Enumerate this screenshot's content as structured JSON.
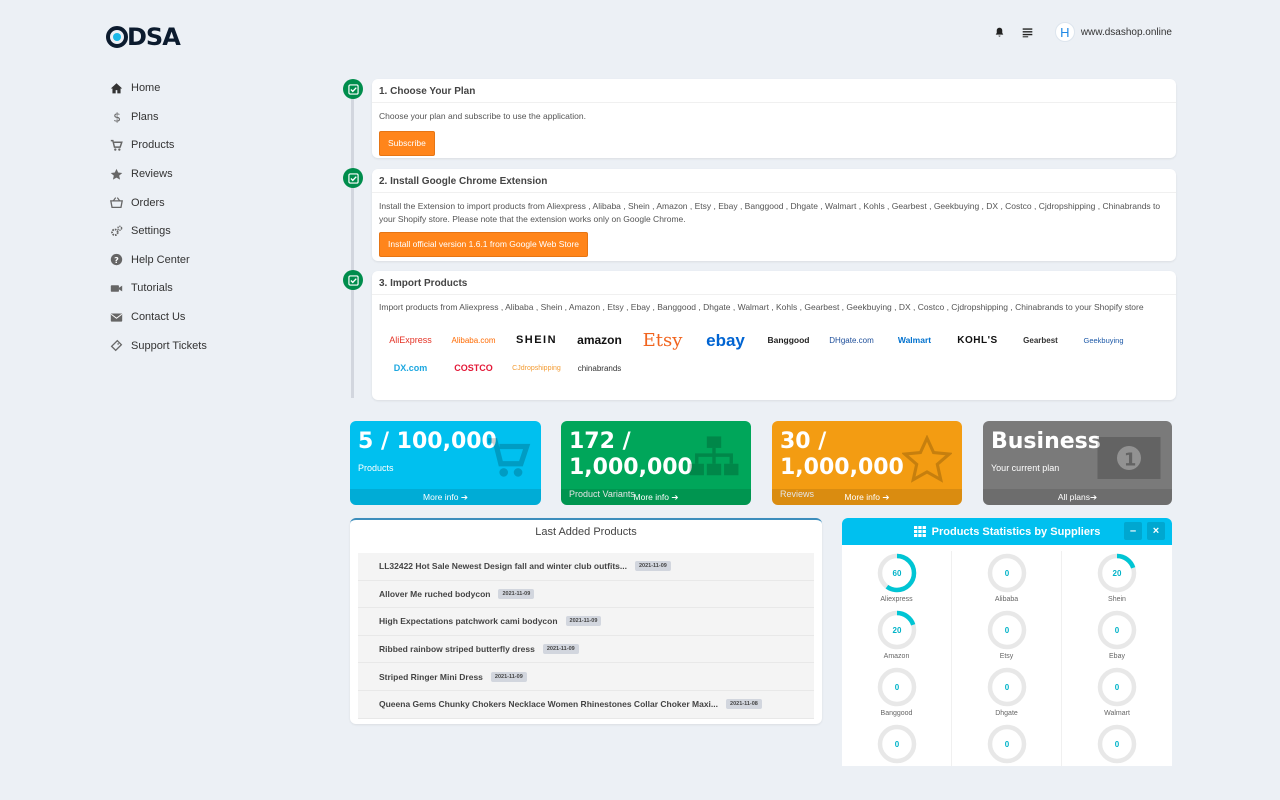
{
  "header": {
    "logo_text": "DSA",
    "site": "www.dsashop.online",
    "avatar_letter": "H"
  },
  "sidebar": {
    "items": [
      {
        "label": "Home",
        "icon": "home-icon"
      },
      {
        "label": "Plans",
        "icon": "dollar-icon"
      },
      {
        "label": "Products",
        "icon": "cart-icon"
      },
      {
        "label": "Reviews",
        "icon": "star-icon"
      },
      {
        "label": "Orders",
        "icon": "basket-icon"
      },
      {
        "label": "Settings",
        "icon": "gears-icon"
      },
      {
        "label": "Help Center",
        "icon": "question-icon"
      },
      {
        "label": "Tutorials",
        "icon": "video-icon"
      },
      {
        "label": "Contact Us",
        "icon": "envelope-icon"
      },
      {
        "label": "Support Tickets",
        "icon": "ticket-icon"
      }
    ]
  },
  "steps": [
    {
      "title": "1. Choose Your Plan",
      "text": "Choose your plan and subscribe to use the application.",
      "button": "Subscribe"
    },
    {
      "title": "2. Install Google Chrome Extension",
      "text": "Install the Extension to import products from Aliexpress , Alibaba , Shein , Amazon , Etsy , Ebay , Banggood , Dhgate , Walmart , Kohls , Gearbest , Geekbuying , DX , Costco , Cjdropshipping , Chinabrands to your Shopify store. Please note that the extension works only on Google Chrome.",
      "button": "Install official version 1.6.1 from Google Web Store"
    },
    {
      "title": "3. Import Products",
      "text": "Import products from Aliexpress , Alibaba , Shein , Amazon , Etsy , Ebay , Banggood , Dhgate , Walmart , Kohls , Gearbest , Geekbuying , DX , Costco , Cjdropshipping , Chinabrands to your Shopify store"
    }
  ],
  "brands": [
    {
      "label": "AliExpress",
      "color": "#e43225"
    },
    {
      "label": "Alibaba.com",
      "color": "#ff6a00"
    },
    {
      "label": "SHEIN",
      "color": "#111111"
    },
    {
      "label": "amazon",
      "color": "#111111"
    },
    {
      "label": "Etsy",
      "color": "#f1641e"
    },
    {
      "label": "ebay",
      "color": "#0064d2"
    },
    {
      "label": "Banggood",
      "color": "#222222"
    },
    {
      "label": "DHgate.com",
      "color": "#1d4e9a"
    },
    {
      "label": "Walmart",
      "color": "#0071ce"
    },
    {
      "label": "KOHL'S",
      "color": "#111111"
    },
    {
      "label": "Gearbest",
      "color": "#333333"
    },
    {
      "label": "Geekbuying",
      "color": "#1e5aa8"
    },
    {
      "label": "DX.com",
      "color": "#1ca7e0"
    },
    {
      "label": "COSTCO",
      "color": "#e31837"
    },
    {
      "label": "CJdropshipping",
      "color": "#f39c34"
    },
    {
      "label": "chinabrands",
      "color": "#333333"
    }
  ],
  "stats": [
    {
      "big": "5 / 100,000",
      "label": "Products",
      "footer": "More info",
      "color": "#00c0ef",
      "icon": "cart-icon"
    },
    {
      "big": "172 / 1,000,000",
      "label": "Product Variants",
      "footer": "More info",
      "color": "#00a65a",
      "icon": "sitemap-icon"
    },
    {
      "big": "30 / 1,000,000",
      "label": "Reviews",
      "footer": "More info",
      "color": "#f39c12",
      "icon": "star-icon"
    },
    {
      "big": "Business",
      "label": "Your current plan",
      "footer": "All plans",
      "color": "#7a7a7a",
      "icon": "money-icon"
    }
  ],
  "last_added": {
    "title": "Last Added Products",
    "items": [
      {
        "name": "LL32422 Hot Sale Newest Design fall and winter club outfits...",
        "date": "2021-11-09"
      },
      {
        "name": "Allover Me ruched bodycon",
        "date": "2021-11-09"
      },
      {
        "name": "High Expectations patchwork cami bodycon",
        "date": "2021-11-09"
      },
      {
        "name": "Ribbed rainbow striped butterfly dress",
        "date": "2021-11-09"
      },
      {
        "name": "Striped Ringer Mini Dress",
        "date": "2021-11-09"
      },
      {
        "name": "Queena Gems Chunky Chokers Necklace Women Rhinestones Collar Choker Maxi...",
        "date": "2021-11-08"
      }
    ]
  },
  "supplier_stats": {
    "title": "Products Statistics by Suppliers",
    "minimize": "–",
    "close": "×",
    "items": [
      {
        "name": "Aliexpress",
        "value": 60
      },
      {
        "name": "Alibaba",
        "value": 0
      },
      {
        "name": "Shein",
        "value": 20
      },
      {
        "name": "Amazon",
        "value": 20
      },
      {
        "name": "Etsy",
        "value": 0
      },
      {
        "name": "Ebay",
        "value": 0
      },
      {
        "name": "Banggood",
        "value": 0
      },
      {
        "name": "Dhgate",
        "value": 0
      },
      {
        "name": "Walmart",
        "value": 0
      },
      {
        "name": "",
        "value": 0
      },
      {
        "name": "",
        "value": 0
      },
      {
        "name": "",
        "value": 0
      }
    ]
  },
  "colors": {
    "accent": "#00c0ef",
    "step_check": "#008d4c",
    "button_orange": "#ff851b",
    "donut_fill": "#00c5d4",
    "donut_track": "#e8e8e8"
  }
}
